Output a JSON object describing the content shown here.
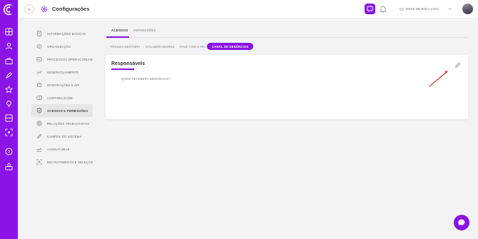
{
  "header": {
    "expand_icon": "»",
    "page_title": "Configurações",
    "company": "BONS DE BOLA LTDA."
  },
  "menu": [
    {
      "label": "INFORMAÇÕES BÁSICAS",
      "icon": "document-icon",
      "active": false
    },
    {
      "label": "ORGANIZAÇÃO",
      "icon": "org-icon",
      "active": false
    },
    {
      "label": "PROCESSOS OPERACIONAIS",
      "icon": "process-icon",
      "active": false
    },
    {
      "label": "DESENVOLVIMENTO",
      "icon": "growth-icon",
      "active": false
    },
    {
      "label": "INTEGRAÇÕES E API",
      "icon": "integration-icon",
      "active": false
    },
    {
      "label": "CONTABILIDADE",
      "icon": "money-icon",
      "active": false
    },
    {
      "label": "ACESSOS E PERMISSÕES",
      "icon": "shield-icon",
      "active": true
    },
    {
      "label": "RELAÇÕES TRABALHISTAS",
      "icon": "labor-icon",
      "active": false
    },
    {
      "label": "CAMPOS DO SISTEMA",
      "icon": "pencil-icon",
      "active": false
    },
    {
      "label": "ASSINATURAS",
      "icon": "signature-icon",
      "active": false
    },
    {
      "label": "RECRUTAMENTO E SELEÇÃO",
      "icon": "recruit-icon",
      "active": false
    }
  ],
  "tabs": [
    {
      "label": "ACESSOS",
      "active": true
    },
    {
      "label": "PERMISSÕES",
      "active": false
    }
  ],
  "subtabs": [
    {
      "label": "PESSOA GESTORA",
      "active": false
    },
    {
      "label": "COLABORADORES",
      "active": false
    },
    {
      "label": "FALE COM O RH",
      "active": false
    },
    {
      "label": "CANAL DE DENÚNCIAS",
      "active": true
    }
  ],
  "card": {
    "title": "Responsáveis",
    "question": "QUEM RECEBERÁ DENÚNCIAS?",
    "value": "-"
  },
  "colors": {
    "accent": "#8a14e6",
    "background": "#f3f3f5",
    "annotation_arrow": "#e0302a"
  }
}
